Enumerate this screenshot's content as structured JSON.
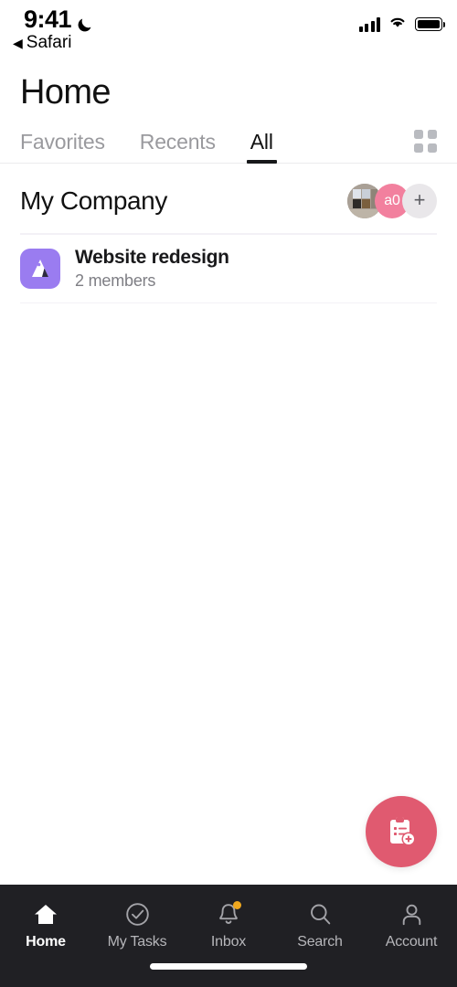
{
  "status_bar": {
    "time": "9:41",
    "dnd_icon": "crescent-moon-icon",
    "back_label": "Safari",
    "back_caret": "◀",
    "signal_icon": "cellular-signal-icon",
    "wifi_icon": "wifi-icon",
    "battery_icon": "battery-full-icon"
  },
  "header": {
    "title": "Home",
    "tabs": [
      {
        "label": "Favorites",
        "active": false
      },
      {
        "label": "Recents",
        "active": false
      },
      {
        "label": "All",
        "active": true
      }
    ],
    "grid_view_icon": "grid-view-icon"
  },
  "section": {
    "title": "My Company",
    "avatars": [
      {
        "type": "photo",
        "name": "member-photo-avatar"
      },
      {
        "type": "initials",
        "label": "a0",
        "color": "#f2809e"
      }
    ],
    "add_member_label": "+"
  },
  "projects": [
    {
      "name": "Website redesign",
      "members": "2 members",
      "icon": "mountain-icon",
      "icon_color": "#9a7cf0"
    }
  ],
  "fab": {
    "icon": "add-task-clipboard-icon",
    "color": "#e05a70"
  },
  "bottom_nav": {
    "items": [
      {
        "label": "Home",
        "icon": "home-icon",
        "active": true,
        "badge": false
      },
      {
        "label": "My Tasks",
        "icon": "check-circle-icon",
        "active": false,
        "badge": false
      },
      {
        "label": "Inbox",
        "icon": "bell-icon",
        "active": false,
        "badge": true
      },
      {
        "label": "Search",
        "icon": "search-icon",
        "active": false,
        "badge": false
      },
      {
        "label": "Account",
        "icon": "person-icon",
        "active": false,
        "badge": false
      }
    ],
    "badge_color": "#f0a81e",
    "background": "#202024"
  }
}
